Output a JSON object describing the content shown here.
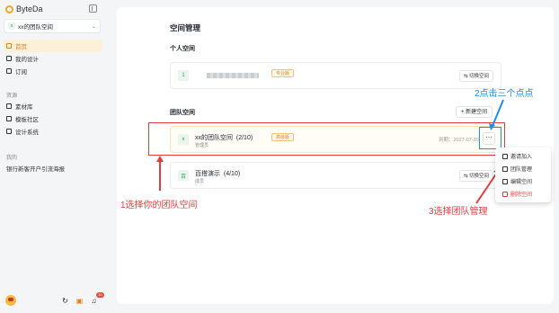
{
  "app": {
    "name": "ByteDa"
  },
  "space_selector": {
    "badge": "x",
    "label": "xx的团队空间"
  },
  "sidebar": {
    "items": [
      {
        "label": "首页",
        "icon": "home-icon"
      },
      {
        "label": "我的设计",
        "icon": "grid-icon"
      },
      {
        "label": "订阅",
        "icon": "card-icon"
      }
    ],
    "section_resources": "资源",
    "resource_items": [
      {
        "label": "素材库",
        "icon": "image-icon"
      },
      {
        "label": "模板社区",
        "icon": "template-icon"
      },
      {
        "label": "设计系统",
        "icon": "palette-icon"
      }
    ],
    "section_mine": "我的",
    "mine_items": [
      {
        "label": "银行新客开户引流海报"
      }
    ],
    "notification_count": "30"
  },
  "main": {
    "title": "空间管理",
    "personal_title": "个人空间",
    "personal_card": {
      "badge": "1",
      "tag": "专业版",
      "switch": "⇆ 切换空间"
    },
    "team_title": "团队空间",
    "new_space": "+ 新建空间",
    "team_cards": [
      {
        "badge": "x",
        "name": "xx的团队空间",
        "count": "(2/10)",
        "tag": "高级版",
        "sub": "管理员",
        "date": "到期：2027-07-30"
      },
      {
        "badge": "百",
        "name": "百搭演示",
        "count": "(4/10)",
        "sub": "成员",
        "switch": "⇆ 切换空间"
      }
    ],
    "more_label": "···"
  },
  "menu": {
    "items": [
      {
        "label": "邀请加入"
      },
      {
        "label": "团队管理"
      },
      {
        "label": "编辑空间"
      },
      {
        "label": "删除空间"
      }
    ]
  },
  "annotations": {
    "step1": "1选择你的团队空间",
    "step2": "2点击三个点点",
    "step3": "3选择团队管理"
  },
  "colors": {
    "accent": "#d9822b",
    "annotation_red": "#e23c3c",
    "annotation_blue": "#1f8ef1"
  }
}
